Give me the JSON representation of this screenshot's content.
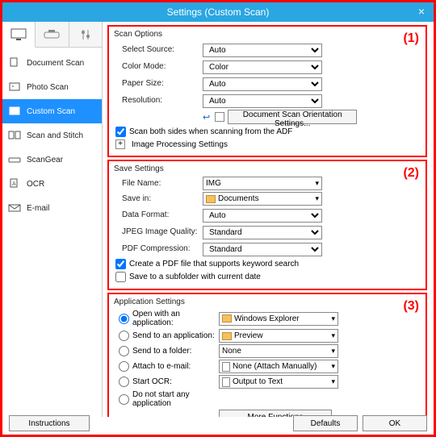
{
  "window": {
    "title": "Settings (Custom Scan)"
  },
  "sidebar": {
    "items": [
      {
        "label": "Document Scan"
      },
      {
        "label": "Photo Scan"
      },
      {
        "label": "Custom Scan"
      },
      {
        "label": "Scan and Stitch"
      },
      {
        "label": "ScanGear"
      },
      {
        "label": "OCR"
      },
      {
        "label": "E-mail"
      }
    ]
  },
  "badges": {
    "p1": "(1)",
    "p2": "(2)",
    "p3": "(3)"
  },
  "scanopt": {
    "title": "Scan Options",
    "source_label": "Select Source:",
    "source_value": "Auto",
    "color_label": "Color Mode:",
    "color_value": "Color",
    "paper_label": "Paper Size:",
    "paper_value": "Auto",
    "res_label": "Resolution:",
    "res_value": "Auto",
    "orient_btn": "Document Scan Orientation Settings...",
    "both_sides": "Scan both sides when scanning from the ADF",
    "imgproc": "Image Processing Settings"
  },
  "save": {
    "title": "Save Settings",
    "fname_label": "File Name:",
    "fname_value": "IMG",
    "savein_label": "Save in:",
    "savein_value": "Documents",
    "datafmt_label": "Data Format:",
    "datafmt_value": "Auto",
    "jpeg_label": "JPEG Image Quality:",
    "jpeg_value": "Standard",
    "pdfc_label": "PDF Compression:",
    "pdfc_value": "Standard",
    "pdf_kw": "Create a PDF file that supports keyword search",
    "subfolder": "Save to a subfolder with current date"
  },
  "app": {
    "title": "Application Settings",
    "open_label": "Open with an application:",
    "open_value": "Windows Explorer",
    "sendapp_label": "Send to an application:",
    "sendapp_value": "Preview",
    "sendfolder_label": "Send to a folder:",
    "sendfolder_value": "None",
    "attach_label": "Attach to e-mail:",
    "attach_value": "None (Attach Manually)",
    "ocr_label": "Start OCR:",
    "ocr_value": "Output to Text",
    "nostart": "Do not start any application",
    "more_btn": "More Functions"
  },
  "footer": {
    "instructions": "Instructions",
    "defaults": "Defaults",
    "ok": "OK"
  }
}
